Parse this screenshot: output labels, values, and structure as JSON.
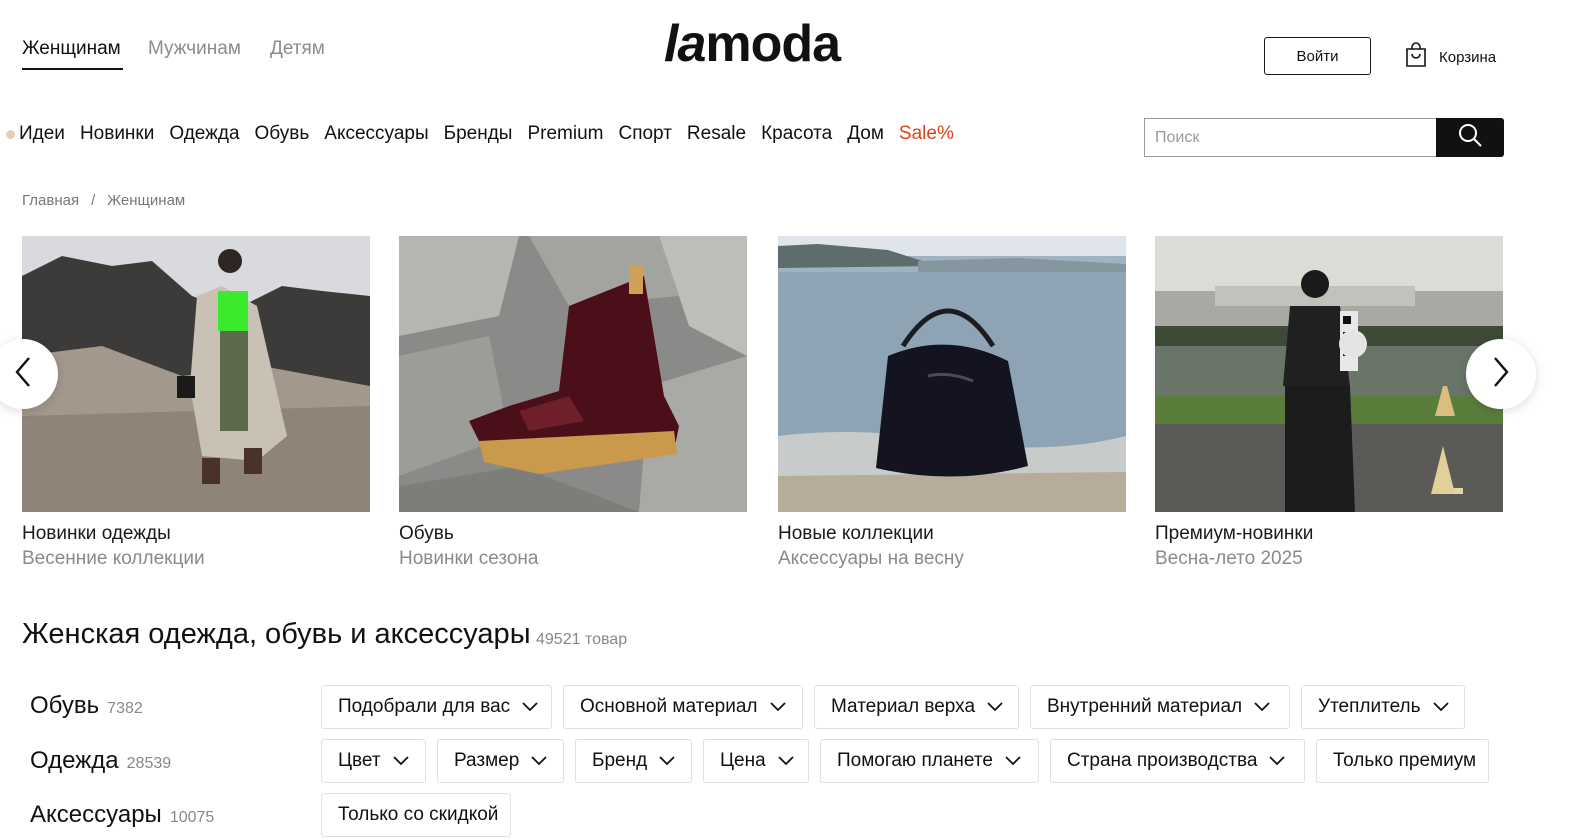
{
  "header": {
    "gender_tabs": [
      "Женщинам",
      "Мужчинам",
      "Детям"
    ],
    "logo_text_a": "la",
    "logo_text_b": "moda",
    "login_label": "Войти",
    "cart_label": "Корзина"
  },
  "nav": {
    "items": [
      "Идеи",
      "Новинки",
      "Одежда",
      "Обувь",
      "Аксессуары",
      "Бренды",
      "Premium",
      "Спорт",
      "Resale",
      "Красота",
      "Дом",
      "Sale%"
    ]
  },
  "search": {
    "placeholder": "Поиск"
  },
  "breadcrumb": {
    "items": [
      "Главная",
      "Женщинам"
    ],
    "separator": "/"
  },
  "cards": [
    {
      "title": "Новинки одежды",
      "subtitle": "Весенние коллекции"
    },
    {
      "title": "Обувь",
      "subtitle": "Новинки сезона"
    },
    {
      "title": "Новые коллекции",
      "subtitle": "Аксессуары на весну"
    },
    {
      "title": "Премиум-новинки",
      "subtitle": "Весна-лето 2025"
    }
  ],
  "section": {
    "title": "Женская одежда, обувь и аксессуары",
    "count": "49521 товар"
  },
  "categories": [
    {
      "label": "Обувь",
      "count": "7382"
    },
    {
      "label": "Одежда",
      "count": "28539"
    },
    {
      "label": "Аксессуары",
      "count": "10075"
    }
  ],
  "filters": [
    "Подобрали для вас",
    "Основной материал",
    "Материал верха",
    "Внутренний материал",
    "Утеплитель",
    "Цвет",
    "Размер",
    "Бренд",
    "Цена",
    "Помогаю планете",
    "Страна производства",
    "Только премиум",
    "Только со скидкой"
  ],
  "colors": {
    "sale_accent": "#e0401a",
    "dark": "#111111"
  }
}
